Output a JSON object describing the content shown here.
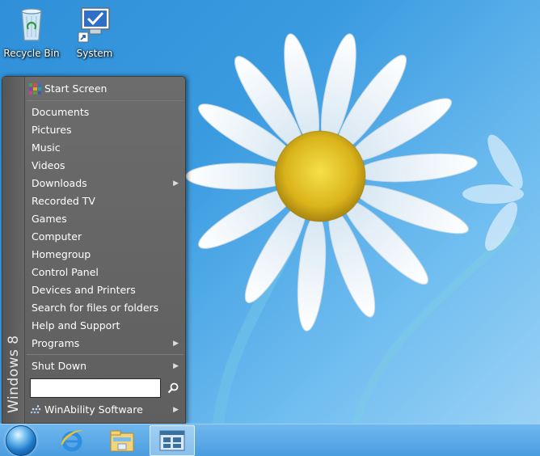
{
  "desktop": {
    "icons": [
      {
        "label": "Recycle Bin",
        "icon": "recycle-bin-icon"
      },
      {
        "label": "System",
        "icon": "system-icon"
      }
    ]
  },
  "start_menu": {
    "side_label": "Windows 8",
    "start_screen": {
      "label": "Start Screen",
      "icon": "start-screen-icon"
    },
    "items": [
      {
        "label": "Documents",
        "submenu": false
      },
      {
        "label": "Pictures",
        "submenu": false
      },
      {
        "label": "Music",
        "submenu": false
      },
      {
        "label": "Videos",
        "submenu": false
      },
      {
        "label": "Downloads",
        "submenu": true
      },
      {
        "label": "Recorded TV",
        "submenu": false
      },
      {
        "label": "Games",
        "submenu": false
      },
      {
        "label": "Computer",
        "submenu": false
      },
      {
        "label": "Homegroup",
        "submenu": false
      },
      {
        "label": "Control Panel",
        "submenu": false
      },
      {
        "label": "Devices and Printers",
        "submenu": false
      },
      {
        "label": "Search for files or folders",
        "submenu": false
      },
      {
        "label": "Help and Support",
        "submenu": false
      },
      {
        "label": "Programs",
        "submenu": true
      }
    ],
    "shutdown": {
      "label": "Shut Down",
      "submenu": true
    },
    "search": {
      "value": "",
      "placeholder": ""
    },
    "vendor": {
      "label": "WinAbility Software",
      "submenu": true
    }
  },
  "taskbar": {
    "items": [
      {
        "icon": "start-orb-icon"
      },
      {
        "icon": "internet-explorer-icon"
      },
      {
        "icon": "file-explorer-icon"
      },
      {
        "icon": "start8-icon"
      }
    ]
  },
  "colors": {
    "menu_bg": "#666666",
    "taskbar": "#5aa8e6",
    "desktop": "#3a9be0"
  }
}
